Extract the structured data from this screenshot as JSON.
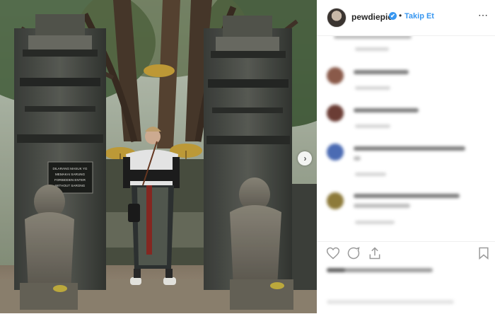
{
  "post": {
    "username": "pewdiepie",
    "verified_mark": "✔",
    "separator": "•",
    "follow_label": "Takip Et",
    "more_label": "⋯",
    "photo_sign_text": [
      "DILARANG MASUK YG",
      "MEMAKAI SARUNG",
      "FORBIDDEN ENTER",
      "WITHOUT SARONG"
    ],
    "next_icon": "chevron-right-icon"
  },
  "actions": {
    "icons": [
      "heart-icon",
      "comment-icon",
      "share-icon",
      "bookmark-icon"
    ]
  },
  "colors": {
    "accent": "#3897f0",
    "username": "#262626",
    "divider": "#efefef"
  }
}
